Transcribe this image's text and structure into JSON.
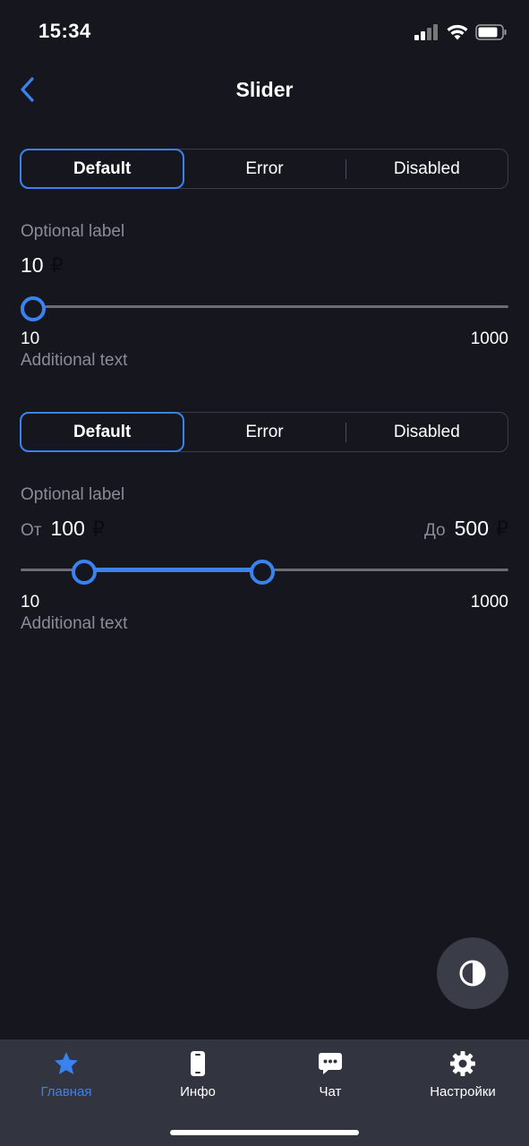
{
  "status_bar": {
    "time": "15:34"
  },
  "nav": {
    "title": "Slider",
    "back_icon": "chevron-left-icon"
  },
  "colors": {
    "accent": "#3a82f0",
    "background": "#16171e",
    "tabbar": "#32343f"
  },
  "slider_single": {
    "segments": [
      "Default",
      "Error",
      "Disabled"
    ],
    "selected_segment": "Default",
    "label": "Optional label",
    "value": "10",
    "currency": "₽",
    "min": "10",
    "max": "1000",
    "value_fraction": 0.0,
    "helper": "Additional text"
  },
  "slider_range": {
    "segments": [
      "Default",
      "Error",
      "Disabled"
    ],
    "selected_segment": "Default",
    "label": "Optional label",
    "from_prefix": "От",
    "from_value": "100",
    "to_prefix": "До",
    "to_value": "500",
    "currency": "₽",
    "min": "10",
    "max": "1000",
    "from_fraction": 0.111,
    "to_fraction": 0.495,
    "helper": "Additional text"
  },
  "theme_toggle": {
    "icon": "contrast-icon"
  },
  "tabbar": {
    "items": [
      {
        "label": "Главная",
        "icon": "star-icon",
        "active": true
      },
      {
        "label": "Инфо",
        "icon": "phone-icon",
        "active": false
      },
      {
        "label": "Чат",
        "icon": "chat-icon",
        "active": false
      },
      {
        "label": "Настройки",
        "icon": "gear-icon",
        "active": false
      }
    ]
  }
}
